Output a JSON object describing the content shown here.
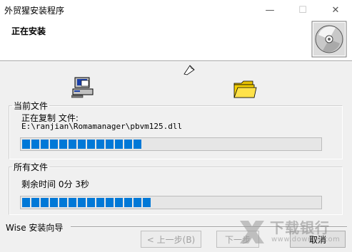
{
  "window": {
    "title": "外贸猩安装程序",
    "minimize_glyph": "—",
    "maximize_glyph": "☐",
    "close_glyph": "✕"
  },
  "header": {
    "title": "正在安装",
    "icon": "cd-disc-icon"
  },
  "animation": {
    "source_icon": "computer-icon",
    "flying_icon": "paper-icon",
    "target_icon": "folder-icon"
  },
  "current_file": {
    "group_label": "当前文件",
    "status": "正在复制 文件:",
    "path": "E:\\ranjian\\Romamanager\\pbvm125.dll",
    "progress_percent": 40,
    "progress_blocks": 13
  },
  "all_files": {
    "group_label": "所有文件",
    "remaining": "剩余时间 0分 3秒",
    "progress_percent": 43,
    "progress_blocks": 14
  },
  "footer": {
    "brand": "Wise 安装向导",
    "back_label": "< 上一步(B)",
    "next_label": "下一步",
    "cancel_label": "取消"
  },
  "watermark": {
    "text": "下载银行",
    "sub": "www.downcc.com"
  },
  "colors": {
    "progress": "#0078d7",
    "dialog_bg": "#f0f0f0"
  }
}
